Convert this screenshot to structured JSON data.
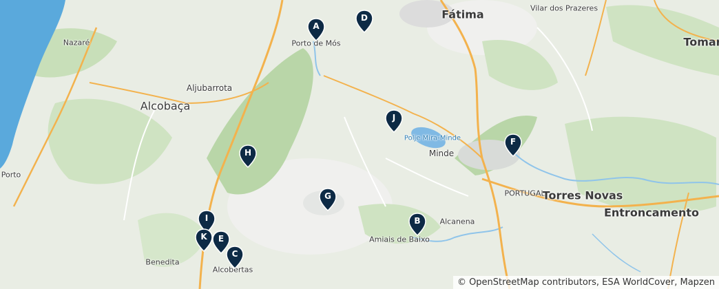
{
  "attribution": "© OpenStreetMap contributors, ESA WorldCover, Mapzen",
  "places": [
    {
      "id": "fatima",
      "label": "Fátima"
    },
    {
      "id": "vilar",
      "label": "Vilar dos Prazeres"
    },
    {
      "id": "tomar",
      "label": "Tomar"
    },
    {
      "id": "nazare",
      "label": "Nazaré"
    },
    {
      "id": "portodemos",
      "label": "Porto de Mós"
    },
    {
      "id": "aljubarrota",
      "label": "Aljubarrota"
    },
    {
      "id": "alcobaca",
      "label": "Alcobaça"
    },
    {
      "id": "polje",
      "label": "Polje Mira-Minde"
    },
    {
      "id": "minde",
      "label": "Minde"
    },
    {
      "id": "portugal",
      "label": "PORTUGAL"
    },
    {
      "id": "torresnovas",
      "label": "Torres Novas"
    },
    {
      "id": "entroncamento",
      "label": "Entroncamento"
    },
    {
      "id": "porto",
      "label": "Porto"
    },
    {
      "id": "alcanena",
      "label": "Alcanena"
    },
    {
      "id": "amiais",
      "label": "Amiais de Baixo"
    },
    {
      "id": "benedita",
      "label": "Benedita"
    },
    {
      "id": "alcobertas",
      "label": "Alcobertas"
    }
  ],
  "markers": [
    {
      "id": "A",
      "label": "A"
    },
    {
      "id": "D",
      "label": "D"
    },
    {
      "id": "J",
      "label": "J"
    },
    {
      "id": "F",
      "label": "F"
    },
    {
      "id": "H",
      "label": "H"
    },
    {
      "id": "G",
      "label": "G"
    },
    {
      "id": "B",
      "label": "B"
    },
    {
      "id": "I",
      "label": "I"
    },
    {
      "id": "K",
      "label": "K"
    },
    {
      "id": "E",
      "label": "E"
    },
    {
      "id": "C",
      "label": "C"
    }
  ],
  "colors": {
    "sea": "#5aa9dc",
    "land": "#e9ede4",
    "forest": "#c4dcb4",
    "road": "#f3b24d",
    "river": "#8fc4ea",
    "marker": "#0d2a45"
  }
}
